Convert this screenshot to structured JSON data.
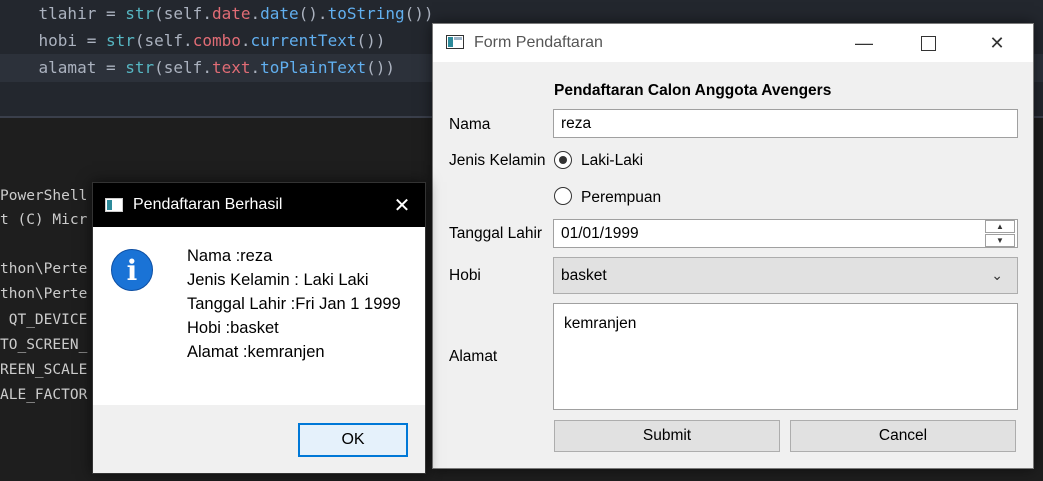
{
  "editor": {
    "lines": [
      {
        "indent": "    ",
        "var": "tlahir",
        "fn": "str",
        "obj": "self",
        "attr": "date",
        "call": "date",
        "meth": "toString",
        "tail": "())"
      },
      {
        "indent": "    ",
        "var": "hobi",
        "fn": "str",
        "obj": "self",
        "attr": "combo",
        "call": "",
        "meth": "currentText",
        "tail": "())"
      },
      {
        "indent": "    ",
        "var": "alamat",
        "fn": "str",
        "obj": "self",
        "attr": "text",
        "call": "",
        "meth": "toPlainText",
        "tail": "())"
      }
    ],
    "colors": {
      "keyword": "#56b6c2",
      "attr": "#e06c75",
      "method": "#61afef",
      "text": "#abb2bf"
    }
  },
  "terminal": {
    "lines": [
      "PowerShell",
      "t (C) Micr",
      "",
      "thon\\Perte",
      "thon\\Perte",
      " QT_DEVICE",
      "TO_SCREEN_",
      "REEN_SCALE",
      "ALE_FACTOR"
    ]
  },
  "form": {
    "title": "Form Pendaftaran",
    "heading": "Pendaftaran Calon Anggota Avengers",
    "nama_label": "Nama",
    "nama_value": "reza",
    "gender_label": "Jenis Kelamin",
    "gender_options": [
      "Laki-Laki",
      "Perempuan"
    ],
    "gender_selected": "Laki-Laki",
    "tanggal_label": "Tanggal Lahir",
    "tanggal_value": "01/01/1999",
    "hobi_label": "Hobi",
    "hobi_value": "basket",
    "alamat_label": "Alamat",
    "alamat_value": "kemranjen",
    "submit_label": "Submit",
    "cancel_label": "Cancel"
  },
  "message": {
    "title": "Pendaftaran Berhasil",
    "lines": [
      "Nama :reza",
      "Jenis Kelamin : Laki Laki",
      "Tanggal Lahir :Fri Jan 1 1999",
      "Hobi :basket",
      "Alamat :kemranjen"
    ],
    "ok_label": "OK"
  }
}
